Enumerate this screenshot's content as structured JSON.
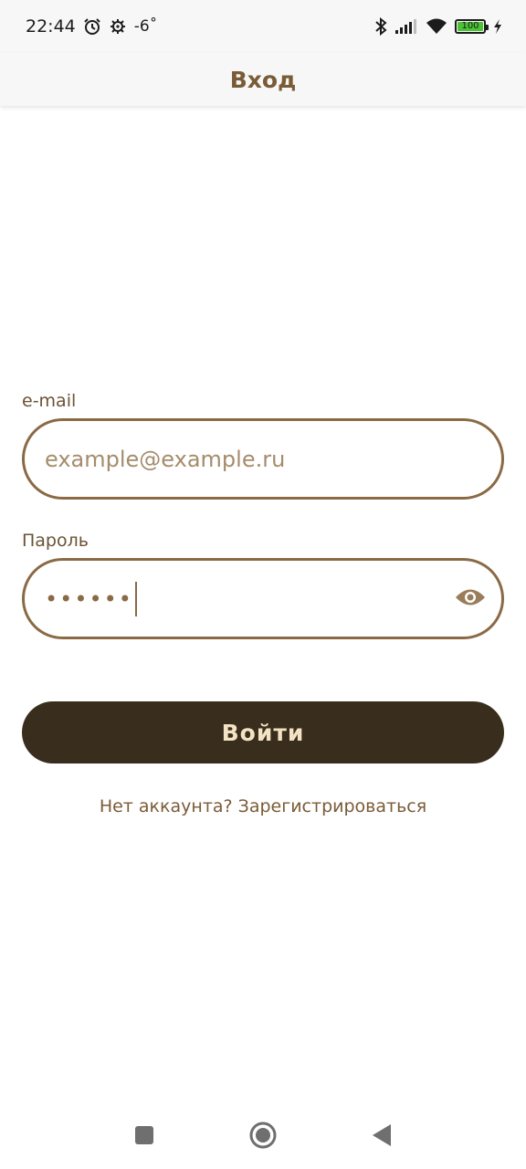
{
  "status_bar": {
    "time": "22:44",
    "temperature": "-6˚",
    "battery": "100",
    "icons": [
      "alarm-icon",
      "settings-gear-icon",
      "bluetooth-icon",
      "signal-icon",
      "wifi-icon",
      "battery-icon",
      "charging-icon"
    ]
  },
  "app_bar": {
    "title": "Вход"
  },
  "form": {
    "email": {
      "label": "e-mail",
      "placeholder": "example@example.ru"
    },
    "password": {
      "label": "Пароль",
      "masked_value": "••••••"
    },
    "submit_label": "Войти",
    "register_prompt": "Нет аккаунта? Зарегистрироваться"
  },
  "colors": {
    "accent": "#7a5b37",
    "border": "#8a6a45",
    "button_bg": "#392e1d",
    "button_text": "#f3e3c4"
  },
  "nav_bar": {
    "icons": [
      "recent-apps-icon",
      "home-icon",
      "back-icon"
    ]
  }
}
